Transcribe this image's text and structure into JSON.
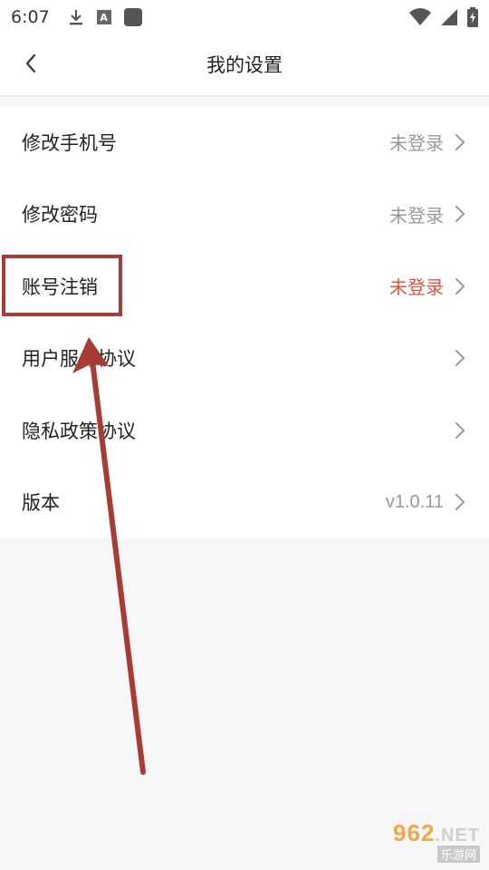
{
  "status_bar": {
    "time": "6:07",
    "left_icons": [
      "download-icon",
      "a-notification-icon",
      "app-square-icon"
    ],
    "right_icons": [
      "wifi-icon",
      "signal-icon",
      "battery-charging-icon"
    ]
  },
  "header": {
    "back_icon": "chevron-left-icon",
    "title": "我的设置"
  },
  "settings": {
    "items": [
      {
        "label": "修改手机号",
        "value": "未登录"
      },
      {
        "label": "修改密码",
        "value": "未登录"
      },
      {
        "label": "账号注销",
        "value": "未登录"
      },
      {
        "label": "用户服务协议",
        "value": ""
      },
      {
        "label": "隐私政策协议",
        "value": ""
      },
      {
        "label": "版本",
        "value": "v1.0.11"
      }
    ]
  },
  "colors": {
    "accent_value": "#e0533e",
    "annotation": "#a83b34",
    "muted_text": "#999999"
  },
  "watermark": {
    "main": "962",
    "suffix": ".NET",
    "sub": "乐游网"
  }
}
